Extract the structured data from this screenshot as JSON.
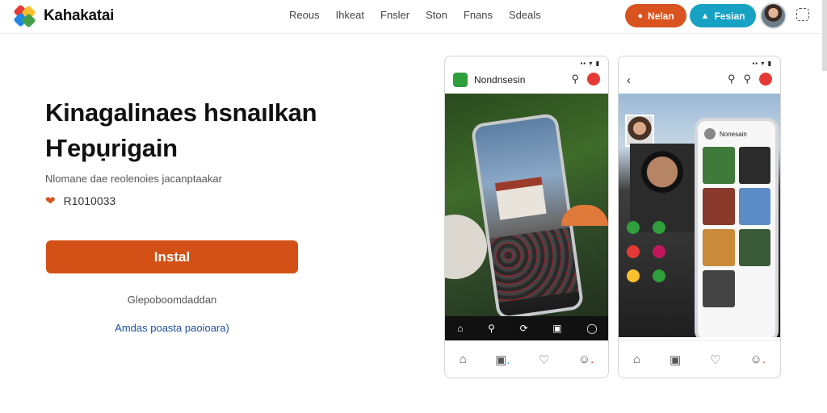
{
  "header": {
    "brand": "Kahakatai",
    "nav": [
      "Reous",
      "Ihkeat",
      "Fnsler",
      "Ston",
      "Fnans",
      "Sdeals"
    ],
    "login_label": "Nelan",
    "register_label": "Fesian"
  },
  "hero": {
    "title_line1": "Kinagalinaes hsnaıIkan",
    "title_line2": "Ҥepụrigain",
    "subtitle": "Nlomane dae reolenoies jacanptaakar",
    "rating": "R1010033",
    "install_label": "Instal",
    "note": "Glepoboomdaddan",
    "link": "Amdas poasta paoioara)"
  },
  "phone_left": {
    "status": "▪▪ ▾ ▮",
    "title": "Nondnsesin"
  },
  "phone_right": {
    "status": "▪▪ ▾ ▮",
    "inner_user": "Nonesain"
  },
  "colors": {
    "accent": "#d35116",
    "teal": "#17a2c4"
  }
}
